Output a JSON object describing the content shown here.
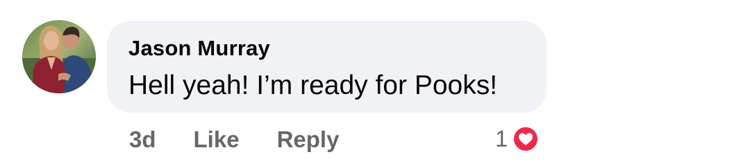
{
  "comment": {
    "author": "Jason Murray",
    "text": "Hell yeah! I’m ready for Pooks!",
    "timestamp": "3d",
    "like_label": "Like",
    "reply_label": "Reply",
    "reaction_count": "1",
    "reaction_icon": "heart-reaction-icon"
  },
  "colors": {
    "bubble_background": "#f0f2f5",
    "text_primary": "#050505",
    "text_secondary": "#65676b",
    "love_reaction": "#f02849"
  }
}
